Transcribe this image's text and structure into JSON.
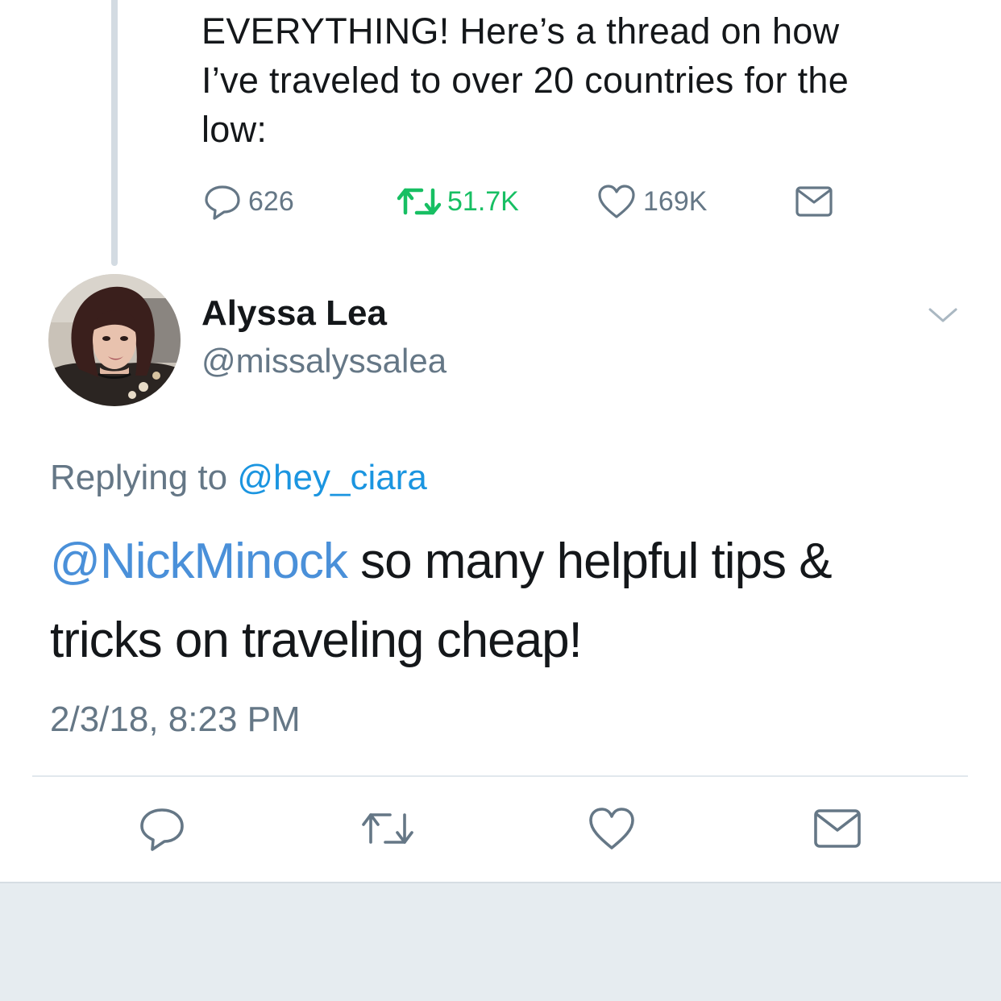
{
  "parent_tweet": {
    "text_lines": [
      "EVERYTHING! Here’s a thread on how",
      "I’ve traveled to over 20 countries for the",
      "low:"
    ],
    "actions": {
      "reply_count": "626",
      "retweet_count": "51.7K",
      "like_count": "169K"
    }
  },
  "tweet": {
    "author": {
      "name": "Alyssa Lea",
      "handle": "@missalyssalea"
    },
    "replying_prefix": "Replying to ",
    "replying_to": "@hey_ciara",
    "mention": "@NickMinock",
    "text_line1_rest": " so many helpful tips &",
    "text_line2": "tricks on traveling cheap!",
    "timestamp": "2/3/18, 8:23 PM"
  },
  "colors": {
    "text": "#14171a",
    "secondary": "#657786",
    "link": "#1b95e0",
    "retweet_green": "#17bf63",
    "thread_line": "#d3dbe2",
    "footer_bg": "#e6ecf0"
  },
  "icons": [
    "reply-icon",
    "retweet-icon",
    "like-icon",
    "share-icon",
    "chevron-down-icon"
  ]
}
